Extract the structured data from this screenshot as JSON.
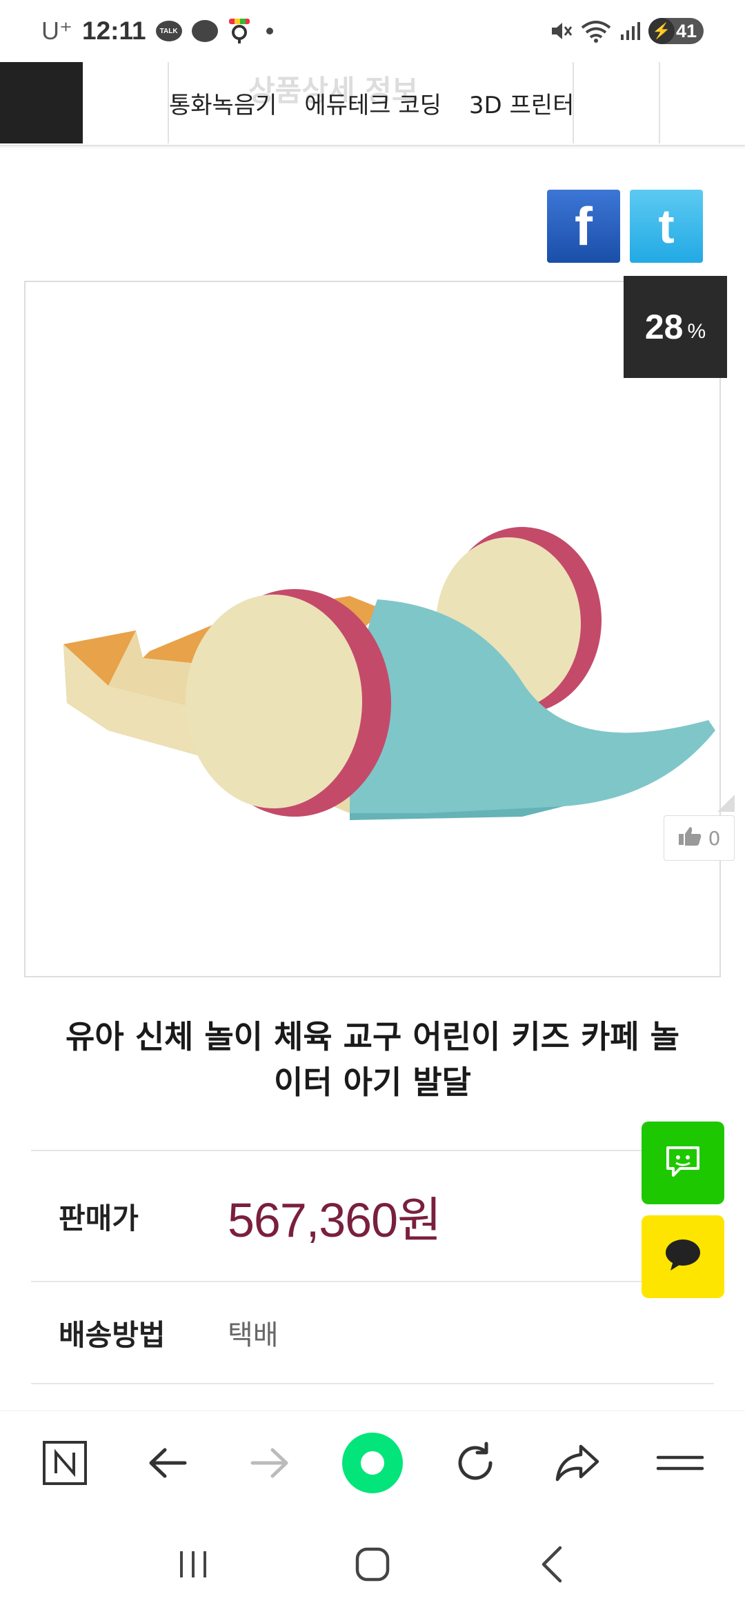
{
  "status_bar": {
    "carrier": "U⁺",
    "time": "12:11",
    "talk_label": "TALK",
    "battery": "41"
  },
  "nav": {
    "ghost_title": "상품상세 정보",
    "items": [
      "통화녹음기",
      "에듀테크 코딩",
      "3D 프린터"
    ]
  },
  "product": {
    "discount_value": "28",
    "discount_unit": "%",
    "like_count": "0",
    "title_line1": "유아 신체 놀이 체육 교구 어린이 키즈 카페 놀",
    "title_line2": "이터 아기 발달",
    "price_label": "판매가",
    "price_value": "567,360원",
    "shipping_label": "배송방법",
    "shipping_value": "택배"
  },
  "colors": {
    "price": "#7a1f3d",
    "naver_green": "#03e57a",
    "talk_green": "#1ec800",
    "kakao_yellow": "#fee500"
  },
  "icons": {
    "share": [
      "facebook-icon",
      "twitter-icon"
    ],
    "fabs": [
      "naver-talk-icon",
      "kakao-chat-icon"
    ],
    "browser": [
      "naver-n-icon",
      "back-arrow-icon",
      "forward-arrow-icon",
      "naver-home-icon",
      "refresh-icon",
      "share-icon",
      "menu-icon"
    ],
    "system": [
      "recent-apps-icon",
      "home-icon",
      "back-icon"
    ]
  }
}
